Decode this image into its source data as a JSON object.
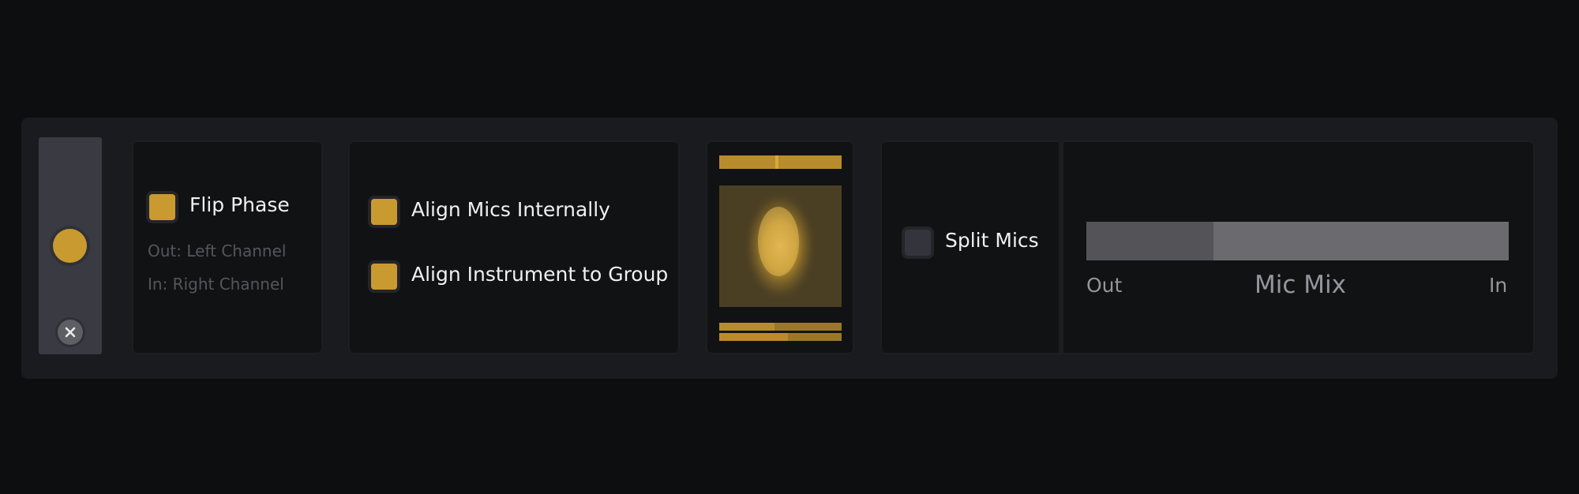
{
  "flip_phase": {
    "label": "Flip Phase",
    "checked": true,
    "out_text": "Out: Left Channel",
    "in_text": "In: Right Channel"
  },
  "align": {
    "internal_label": "Align Mics Internally",
    "internal_checked": true,
    "group_label": "Align Instrument to Group",
    "group_checked": true
  },
  "split_mics": {
    "label": "Split Mics",
    "checked": false
  },
  "mic_mix": {
    "title": "Mic Mix",
    "out_label": "Out",
    "in_label": "In",
    "level": 0.3
  },
  "colors": {
    "accent": "#c99a30",
    "background": "#0d0e10",
    "panel": "#111214"
  },
  "icons": {
    "close": "close-icon",
    "knob": "knob-icon"
  }
}
